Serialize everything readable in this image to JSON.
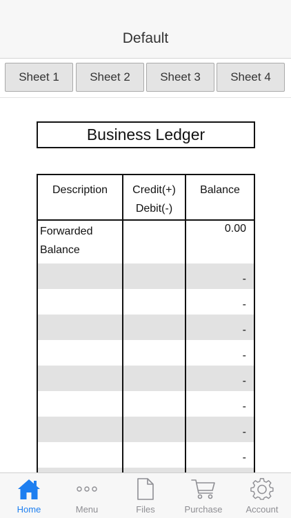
{
  "header": {
    "title": "Default"
  },
  "sheets": [
    {
      "label": "Sheet 1"
    },
    {
      "label": "Sheet 2"
    },
    {
      "label": "Sheet 3"
    },
    {
      "label": "Sheet 4"
    }
  ],
  "ledger": {
    "title": "Business Ledger",
    "columns": {
      "description": "Description",
      "credit_line1": "Credit(+)",
      "credit_line2": "Debit(-)",
      "balance": "Balance"
    },
    "rows": [
      {
        "desc_line1": "Forwarded",
        "desc_line2": "Balance",
        "credit": "",
        "balance": "0.00"
      },
      {
        "desc": "",
        "credit": "",
        "balance": "-"
      },
      {
        "desc": "",
        "credit": "",
        "balance": "-"
      },
      {
        "desc": "",
        "credit": "",
        "balance": "-"
      },
      {
        "desc": "",
        "credit": "",
        "balance": "-"
      },
      {
        "desc": "",
        "credit": "",
        "balance": "-"
      },
      {
        "desc": "",
        "credit": "",
        "balance": "-"
      },
      {
        "desc": "",
        "credit": "",
        "balance": "-"
      },
      {
        "desc": "",
        "credit": "",
        "balance": "-"
      }
    ]
  },
  "tabbar": {
    "items": [
      {
        "label": "Home",
        "icon": "house-icon",
        "active": true
      },
      {
        "label": "Menu",
        "icon": "ellipsis-icon",
        "active": false
      },
      {
        "label": "Files",
        "icon": "document-icon",
        "active": false
      },
      {
        "label": "Purchase",
        "icon": "cart-icon",
        "active": false
      },
      {
        "label": "Account",
        "icon": "gear-icon",
        "active": false
      }
    ]
  },
  "colors": {
    "accent": "#1e7ff0",
    "inactive": "#8e8e93",
    "row_shade": "#e2e2e2"
  }
}
